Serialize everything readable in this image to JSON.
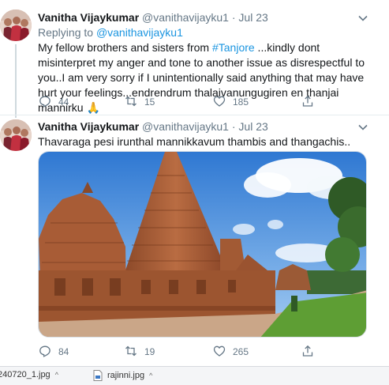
{
  "tweets": [
    {
      "author_name": "Vanitha Vijaykumar",
      "handle": "@vanithavijayku1",
      "separator": "·",
      "date": "Jul 23",
      "replying_prefix": "Replying to",
      "replying_to": "@vanithavijayku1",
      "text_part1": "My fellow brothers and sisters from",
      "hashtag": "#Tanjore",
      "text_part2": " ...kindly dont misinterpret my anger and tone to another issue as disrespectful to you..I am very sorry if I unintentionally said anything that may have hurt your feelings...endrendrum thalaivanungugiren en thanjai mannirku 🙏",
      "reply_count": "44",
      "retweet_count": "15",
      "like_count": "185"
    },
    {
      "author_name": "Vanitha Vijaykumar",
      "handle": "@vanithavijayku1",
      "separator": "·",
      "date": "Jul 23",
      "text": "Thavaraga pesi irunthal mannikkavum thambis and thangachis..",
      "reply_count": "84",
      "retweet_count": "19",
      "like_count": "265"
    }
  ],
  "downloads": [
    {
      "filename": "240720_1.jpg"
    },
    {
      "filename": "rajinni.jpg"
    }
  ],
  "colors": {
    "link": "#1b95e0",
    "secondary_text": "#657786",
    "sky": "#4a8fd9",
    "temple": "#a35a36",
    "grass": "#6aa83a"
  },
  "icons": [
    "reply-icon",
    "retweet-icon",
    "like-icon",
    "share-icon",
    "chevron-down-icon",
    "file-icon"
  ]
}
